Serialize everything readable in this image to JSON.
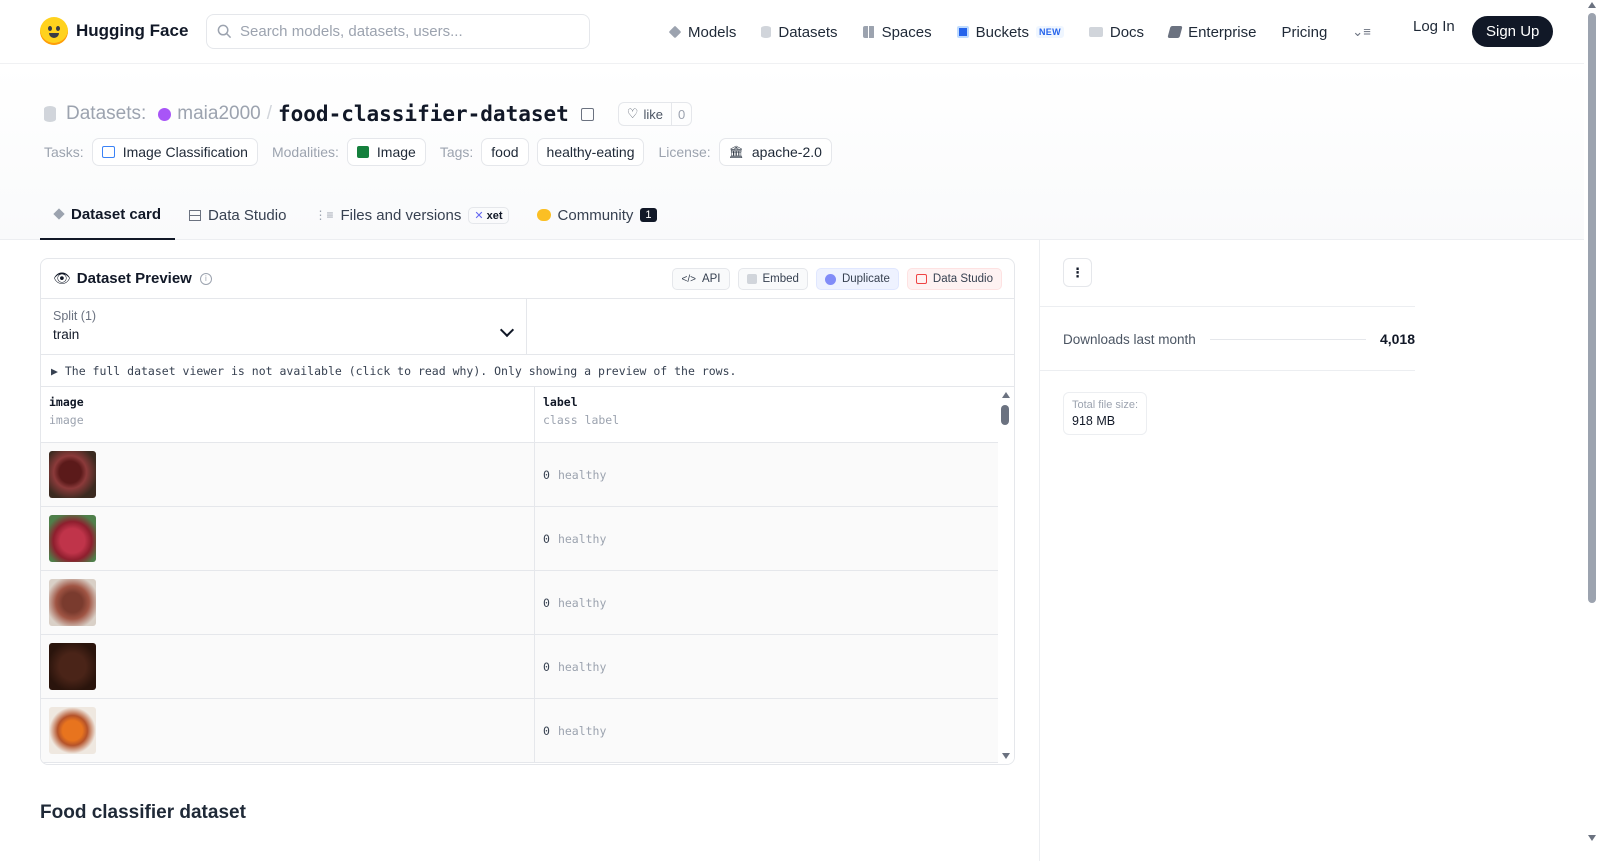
{
  "brand": {
    "name": "Hugging Face"
  },
  "search": {
    "placeholder": "Search models, datasets, users..."
  },
  "nav": {
    "models": "Models",
    "datasets": "Datasets",
    "spaces": "Spaces",
    "buckets": "Buckets",
    "buckets_badge": "NEW",
    "docs": "Docs",
    "enterprise": "Enterprise",
    "pricing": "Pricing",
    "login": "Log In",
    "signup": "Sign Up"
  },
  "repo": {
    "type_label": "Datasets:",
    "owner": "maia2000",
    "separator": "/",
    "name": "food-classifier-dataset",
    "like_label": "like",
    "like_count": "0"
  },
  "meta": {
    "tasks_label": "Tasks:",
    "task": "Image Classification",
    "modalities_label": "Modalities:",
    "modality": "Image",
    "tags_label": "Tags:",
    "tags": [
      "food",
      "healthy-eating"
    ],
    "license_label": "License:",
    "license": "apache-2.0"
  },
  "tabs": {
    "card": "Dataset card",
    "studio": "Data Studio",
    "files": "Files and versions",
    "xet": "xet",
    "community": "Community",
    "community_count": "1"
  },
  "preview": {
    "title": "Dataset Preview",
    "actions": {
      "api": "API",
      "embed": "Embed",
      "duplicate": "Duplicate",
      "studio": "Data Studio"
    },
    "split_label": "Split (1)",
    "split_value": "train",
    "notice": "▶ The full dataset viewer is not available (click to read why). Only showing a preview of the rows.",
    "columns": [
      {
        "name": "image",
        "type": "image"
      },
      {
        "name": "label",
        "type": "class label"
      }
    ],
    "rows": [
      {
        "label_num": "0",
        "label_name": "healthy"
      },
      {
        "label_num": "0",
        "label_name": "healthy"
      },
      {
        "label_num": "0",
        "label_name": "healthy"
      },
      {
        "label_num": "0",
        "label_name": "healthy"
      },
      {
        "label_num": "0",
        "label_name": "healthy"
      }
    ]
  },
  "section_heading": "Food classifier dataset",
  "sidebar": {
    "downloads_label": "Downloads last month",
    "downloads_value": "4,018",
    "size_label": "Total file size:",
    "size_value": "918 MB"
  },
  "colors": {
    "accent": "#111827",
    "avatar": "#a855f7",
    "logo": "#ffd21e"
  }
}
